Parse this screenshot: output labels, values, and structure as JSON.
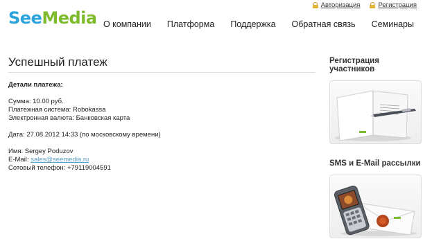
{
  "logo": {
    "part1": "See",
    "part2": "Media"
  },
  "auth": {
    "login": "Авторизация",
    "register": "Регистрация"
  },
  "nav": {
    "items": [
      {
        "label": "О компании"
      },
      {
        "label": "Платформа"
      },
      {
        "label": "Поддержка"
      },
      {
        "label": "Обратная связь"
      },
      {
        "label": "Семинары"
      }
    ]
  },
  "main": {
    "title": "Успешный платеж",
    "details_heading": "Детали платежа:",
    "amount": "Сумма: 10.00 руб.",
    "payment_system": "Платежная система: Robokassa",
    "currency": "Электронная валюта: Банковская карта",
    "date": "Дата: 27.08.2012 14:33 (по московскому времени)",
    "name": "Имя: Sergey Poduzov",
    "email_label": "E-Mail: ",
    "email": "sales@seemedia.ru",
    "phone": "Сотовый телефон: +79119004591"
  },
  "sidebar": {
    "block1_title": "Регистрация участников",
    "block2_title": "SMS и E-Mail рассылки"
  }
}
